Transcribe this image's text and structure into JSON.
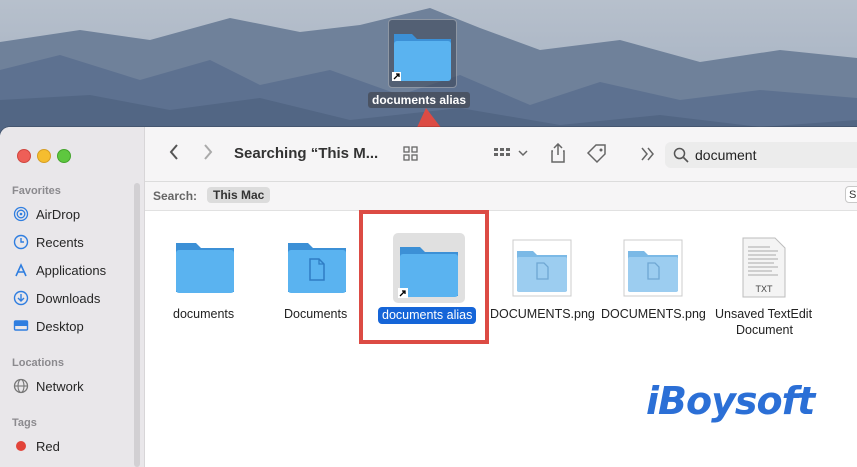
{
  "desktop": {
    "alias_icon_label": "documents alias"
  },
  "window": {
    "title": "Searching “This M...",
    "search_field_value": "document",
    "search_bar": {
      "label": "Search:",
      "scope": "This Mac",
      "save_button_stub": "S"
    }
  },
  "sidebar": {
    "sections": [
      {
        "heading": "Favorites",
        "items": [
          {
            "label": "AirDrop",
            "icon": "airdrop-icon"
          },
          {
            "label": "Recents",
            "icon": "clock-icon"
          },
          {
            "label": "Applications",
            "icon": "applications-icon"
          },
          {
            "label": "Downloads",
            "icon": "download-icon"
          },
          {
            "label": "Desktop",
            "icon": "desktop-icon"
          }
        ]
      },
      {
        "heading": "Locations",
        "items": [
          {
            "label": "Network",
            "icon": "network-icon"
          }
        ]
      },
      {
        "heading": "Tags",
        "items": [
          {
            "label": "Red",
            "icon": "tag-red-dot",
            "color": "#e2443a"
          }
        ]
      }
    ]
  },
  "files": [
    {
      "name": "documents",
      "icon": "folder-icon"
    },
    {
      "name": "Documents",
      "icon": "documents-folder-icon"
    },
    {
      "name": "documents alias",
      "icon": "folder-alias-icon",
      "selected": true
    },
    {
      "name": "DOCUMENTS.png",
      "icon": "png-thumbnail-icon"
    },
    {
      "name": "DOCUMENTS.png",
      "icon": "png-thumbnail-icon"
    },
    {
      "name": "Unsaved TextEdit\nDocument",
      "icon": "txt-file-icon",
      "name_line1": "Unsaved TextEdit",
      "name_line2": "Document",
      "badge": "TXT"
    }
  ],
  "watermark": {
    "text": "iBoysoft",
    "color": "#2b6fd6"
  },
  "colors": {
    "selection": "#1565d8",
    "annotation_red": "#dc4b44",
    "folder_blue": "#5aaee8"
  }
}
